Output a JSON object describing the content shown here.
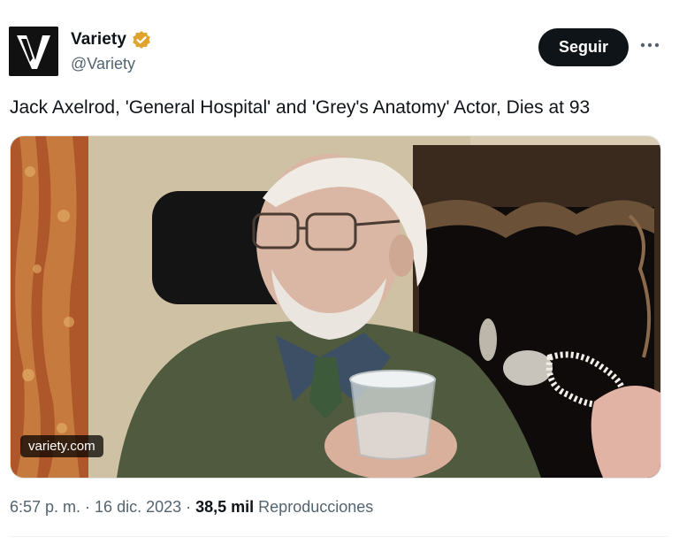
{
  "account": {
    "display_name": "Variety",
    "handle": "@Variety",
    "verified": true,
    "verified_color": "#e0a32b",
    "avatar_letter": "V"
  },
  "actions": {
    "follow_label": "Seguir",
    "more_icon": "more-horizontal-icon"
  },
  "tweet": {
    "text": "Jack Axelrod, 'General Hospital' and 'Grey's Anatomy' Actor, Dies at 93"
  },
  "media": {
    "source_label": "variety.com"
  },
  "meta": {
    "time": "6:57 p. m.",
    "sep1": " · ",
    "date": "16 dic. 2023",
    "sep2": " · ",
    "views_count": "38,5 mil",
    "views_label": " Reproducciones"
  },
  "colors": {
    "button_bg": "#0f1419",
    "secondary_text": "#536471"
  }
}
